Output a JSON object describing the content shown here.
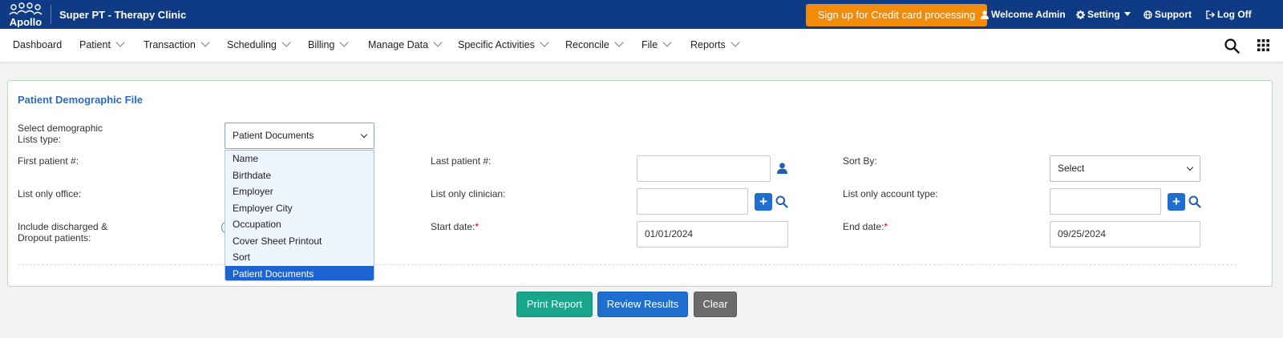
{
  "header": {
    "logo_text": "Apollo",
    "clinic_name": "Super PT - Therapy Clinic",
    "signup_label": "Sign up for Credit card processing",
    "welcome_label": "Welcome Admin",
    "setting_label": "Setting",
    "support_label": "Support",
    "logoff_label": "Log Off"
  },
  "menu": {
    "items": [
      {
        "label": "Dashboard"
      },
      {
        "label": "Patient"
      },
      {
        "label": "Transaction"
      },
      {
        "label": "Scheduling"
      },
      {
        "label": "Billing"
      },
      {
        "label": "Manage Data"
      },
      {
        "label": "Specific Activities"
      },
      {
        "label": "Reconcile"
      },
      {
        "label": "File"
      },
      {
        "label": "Reports"
      }
    ]
  },
  "form": {
    "title": "Patient Demographic File",
    "demographic_label_1": "Select demographic",
    "demographic_label_2": "Lists type:",
    "demographic_value": "Patient Documents",
    "first_patient_label": "First patient #:",
    "last_patient_label": "Last patient #:",
    "last_patient_value": "",
    "sort_by_label": "Sort By:",
    "sort_by_value": "Select",
    "list_office_label": "List only office:",
    "list_clinician_label": "List only clinician:",
    "list_clinician_value": "",
    "list_account_label": "List only account type:",
    "list_account_value": "",
    "discharged_label_1": "Include discharged &",
    "discharged_label_2": "Dropout patients:",
    "start_date_label": "Start date:",
    "start_date_value": "01/01/2024",
    "end_date_label": "End date:",
    "end_date_value": "09/25/2024",
    "required_mark": "*"
  },
  "dropdown": {
    "options": [
      {
        "label": "Name"
      },
      {
        "label": "Birthdate"
      },
      {
        "label": "Employer"
      },
      {
        "label": "Employer City"
      },
      {
        "label": "Occupation"
      },
      {
        "label": "Cover Sheet Printout"
      },
      {
        "label": "Sort"
      },
      {
        "label": "Patient Documents"
      }
    ]
  },
  "buttons": {
    "print_label": "Print Report",
    "review_label": "Review Results",
    "clear_label": "Clear"
  },
  "colors": {
    "header_bg": "#0e3b84",
    "signup_bg": "#f28b0a",
    "accent_blue": "#1f6fd1",
    "print_green": "#19a58a",
    "clear_gray": "#6b6b6b"
  }
}
